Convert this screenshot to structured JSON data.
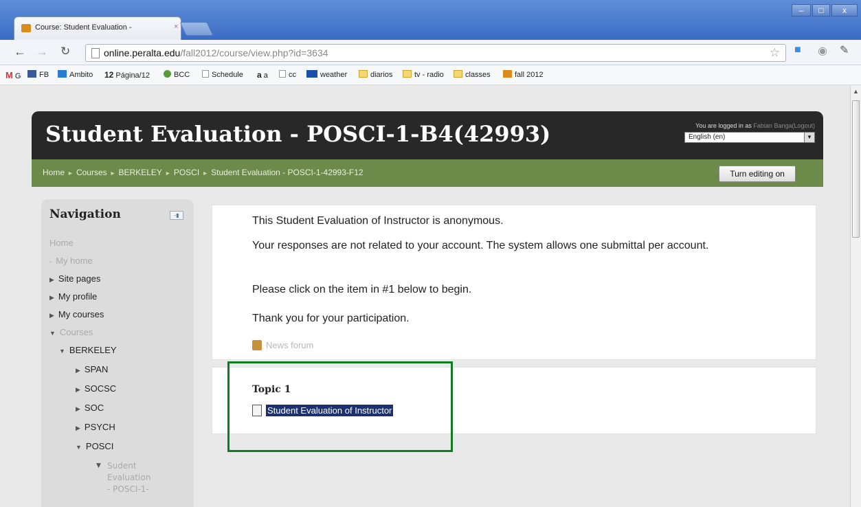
{
  "browser": {
    "tab_title": "Course: Student Evaluation -",
    "tab_close": "×",
    "url_domain": "online.peralta.edu",
    "url_path": "/fall2012/course/view.php?id=3634",
    "window_buttons": [
      "–",
      "□",
      "x"
    ]
  },
  "bookmarks": [
    {
      "label": "G",
      "icon": "gmail-icon"
    },
    {
      "label": "FB",
      "icon": "facebook-icon"
    },
    {
      "label": "Ambito",
      "icon": "ambito-icon"
    },
    {
      "label": "Página/12",
      "icon": "pagina12-icon"
    },
    {
      "label": "BCC",
      "icon": "bcc-icon"
    },
    {
      "label": "Schedule",
      "icon": "page-icon"
    },
    {
      "label": "a",
      "icon": "amazon-icon"
    },
    {
      "label": "cc",
      "icon": "page-icon"
    },
    {
      "label": "weather",
      "icon": "weather-icon"
    },
    {
      "label": "diarios",
      "icon": "folder-icon"
    },
    {
      "label": "tv - radio",
      "icon": "folder-icon"
    },
    {
      "label": "classes",
      "icon": "folder-icon"
    },
    {
      "label": "fall 2012",
      "icon": "moodle-icon"
    }
  ],
  "header": {
    "title": "Student Evaluation - POSCI-1-B4(42993)",
    "login_prefix": "You are logged in as",
    "login_name": "Fabian Banga",
    "logout": "(Logout)",
    "language": "English (en)"
  },
  "breadcrumb": [
    "Home",
    "Courses",
    "BERKELEY",
    "POSCI",
    "Student Evaluation - POSCI-1-42993-F12"
  ],
  "edit_button": "Turn editing on",
  "navigation": {
    "title": "Navigation",
    "items": [
      {
        "label": "Home"
      },
      {
        "label": "My home"
      },
      {
        "label": "Site pages"
      },
      {
        "label": "My profile"
      },
      {
        "label": "My courses"
      },
      {
        "label": "Courses"
      },
      {
        "label": "BERKELEY"
      },
      {
        "label": "SPAN"
      },
      {
        "label": "SOCSC"
      },
      {
        "label": "SOC"
      },
      {
        "label": "PSYCH"
      },
      {
        "label": "POSCI"
      },
      {
        "label": "Sudent Evaluation - POSCI-1-"
      }
    ]
  },
  "intro": {
    "line1": "This Student Evaluation of Instructor is anonymous.",
    "line2": "Your responses are not related to your account. The system allows one submittal per account.",
    "line3": "Please click on the item in #1 below to begin.",
    "line4": "Thank you for your participation.",
    "news_forum": "News forum"
  },
  "topic": {
    "title": "Topic 1",
    "link": "Student Evaluation of Instructor"
  },
  "colors": {
    "header_bg": "#282828",
    "navbar_bg": "#6c8a4a",
    "highlight_border": "#117a22",
    "selection_bg": "#1c2f6e"
  }
}
